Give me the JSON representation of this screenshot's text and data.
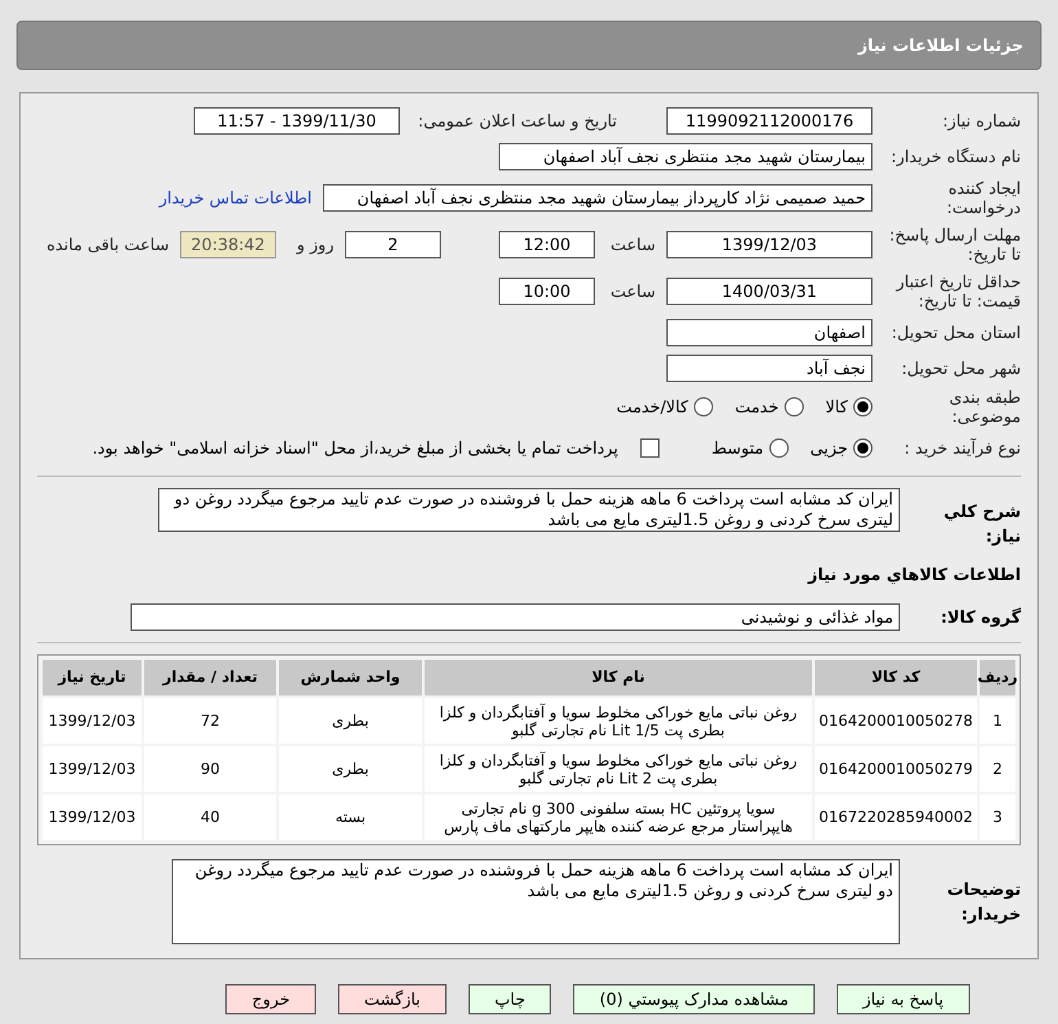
{
  "header": {
    "title": "جزئیات اطلاعات نیاز"
  },
  "need_number": {
    "label": "شماره نیاز:",
    "value": "1199092112000176"
  },
  "announce": {
    "label": "تاریخ و ساعت اعلان عمومی:",
    "value": "1399/11/30 - 11:57"
  },
  "buyer_org": {
    "label": "نام دستگاه خریدار:",
    "value": "بیمارستان شهید مجد منتظری نجف آباد اصفهان"
  },
  "requester": {
    "label": "ایجاد کننده درخواست:",
    "value": "حمید صمیمی نژاد کارپرداز بیمارستان شهید مجد منتظری نجف آباد اصفهان",
    "link": "اطلاعات تماس خریدار"
  },
  "deadline": {
    "label": "مهلت ارسال پاسخ: تا تاریخ:",
    "date": "1399/12/03",
    "time_label": "ساعت",
    "time": "12:00",
    "days": "2",
    "days_label": "روز و",
    "remaining": "20:38:42",
    "remaining_label": "ساعت باقی مانده"
  },
  "validity": {
    "label": "حداقل تاریخ اعتبار قیمت: تا تاریخ:",
    "date": "1400/03/31",
    "time_label": "ساعت",
    "time": "10:00"
  },
  "province": {
    "label": "استان محل تحویل:",
    "value": "اصفهان"
  },
  "city": {
    "label": "شهر محل تحویل:",
    "value": "نجف آباد"
  },
  "category": {
    "label": "طبقه بندی موضوعی:",
    "options": [
      {
        "label": "کالا",
        "selected": true
      },
      {
        "label": "خدمت",
        "selected": false
      },
      {
        "label": "کالا/خدمت",
        "selected": false
      }
    ]
  },
  "process": {
    "label": "نوع فرآیند خرید :",
    "options": [
      {
        "label": "جزیی",
        "selected": true
      },
      {
        "label": "متوسط",
        "selected": false
      }
    ],
    "payment": {
      "label": "پرداخت تمام یا بخشی از مبلغ خرید،از محل \"اسناد خزانه اسلامی\" خواهد بود.",
      "checked": false
    }
  },
  "description": {
    "label": "شرح کلي نياز:",
    "text": "ایران کد مشابه است پرداخت 6 ماهه هزینه حمل با فروشنده در صورت عدم تایید مرجوع میگردد روغن دو لیتری سرخ کردنی و روغن 1.5لیتری مایع می باشد"
  },
  "goods_title": "اطلاعات کالاهاي مورد نياز",
  "goods_group": {
    "label": "گروه کالا:",
    "value": "مواد غذائی و نوشیدنی"
  },
  "table": {
    "columns": [
      "ردیف",
      "کد کالا",
      "نام کالا",
      "واحد شمارش",
      "تعداد / مقدار",
      "تاریخ نیاز"
    ],
    "rows": [
      [
        "1",
        "0164200010050278",
        "روغن نباتی مایع خوراکی مخلوط سویا و آفتابگردان و کلزا بطری پت Lit 1/5 نام تجارتی گلبو",
        "بطری",
        "72",
        "1399/12/03"
      ],
      [
        "2",
        "0164200010050279",
        "روغن نباتی مایع خوراکی مخلوط سویا و آفتابگردان و کلزا بطری پت Lit 2 نام تجارتی گلبو",
        "بطری",
        "90",
        "1399/12/03"
      ],
      [
        "3",
        "0167220285940002",
        "سویا پروتئین HC بسته سلفونی 300 g نام تجارتی هایپراستار مرجع عرضه کننده هایپر مارکتهای ماف پارس",
        "بسته",
        "40",
        "1399/12/03"
      ]
    ]
  },
  "buyer_notes": {
    "label": "توضیحات خریدار:",
    "text": "ایران کد مشابه است پرداخت 6 ماهه هزینه حمل با فروشنده در صورت عدم تایید مرجوع میگردد روغن دو لیتری سرخ کردنی و روغن 1.5لیتری مایع می باشد"
  },
  "buttons": [
    {
      "label": "پاسخ به نیاز",
      "kind": "green"
    },
    {
      "label": "مشاهده مدارک پیوستي (0)",
      "kind": "green"
    },
    {
      "label": "چاپ",
      "kind": "green"
    },
    {
      "label": "بازگشت",
      "kind": "red"
    },
    {
      "label": "خروج",
      "kind": "red"
    }
  ]
}
